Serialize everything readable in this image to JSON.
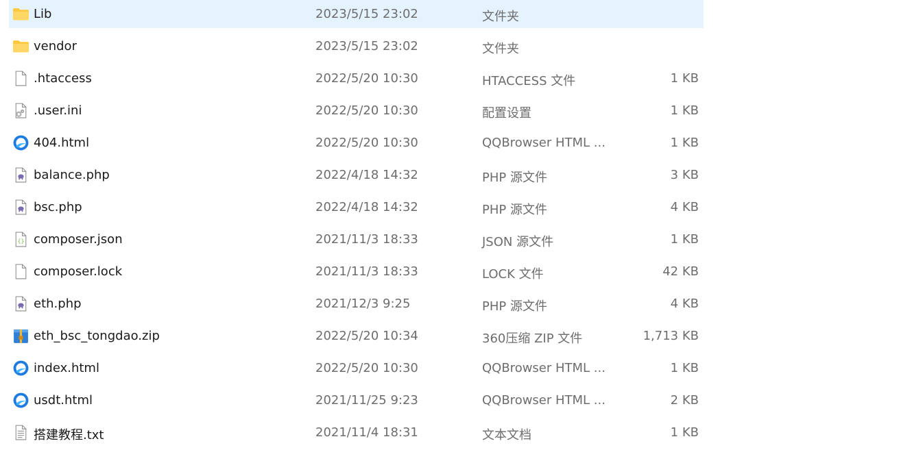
{
  "files": [
    {
      "name": "Lib",
      "date": "2023/5/15 23:02",
      "type": "文件夹",
      "size": "",
      "icon": "folder-icon",
      "selected": true
    },
    {
      "name": "vendor",
      "date": "2023/5/15 23:02",
      "type": "文件夹",
      "size": "",
      "icon": "folder-icon"
    },
    {
      "name": ".htaccess",
      "date": "2022/5/20 10:30",
      "type": "HTACCESS 文件",
      "size": "1 KB",
      "icon": "blank-file-icon"
    },
    {
      "name": ".user.ini",
      "date": "2022/5/20 10:30",
      "type": "配置设置",
      "size": "1 KB",
      "icon": "config-file-icon"
    },
    {
      "name": "404.html",
      "date": "2022/5/20 10:30",
      "type": "QQBrowser HTML ...",
      "size": "1 KB",
      "icon": "qqbrowser-icon"
    },
    {
      "name": "balance.php",
      "date": "2022/4/18 14:32",
      "type": "PHP 源文件",
      "size": "3 KB",
      "icon": "php-file-icon"
    },
    {
      "name": "bsc.php",
      "date": "2022/4/18 14:32",
      "type": "PHP 源文件",
      "size": "4 KB",
      "icon": "php-file-icon"
    },
    {
      "name": "composer.json",
      "date": "2021/11/3 18:33",
      "type": "JSON 源文件",
      "size": "1 KB",
      "icon": "json-file-icon"
    },
    {
      "name": "composer.lock",
      "date": "2021/11/3 18:33",
      "type": "LOCK 文件",
      "size": "42 KB",
      "icon": "blank-file-icon"
    },
    {
      "name": "eth.php",
      "date": "2021/12/3 9:25",
      "type": "PHP 源文件",
      "size": "4 KB",
      "icon": "php-file-icon"
    },
    {
      "name": "eth_bsc_tongdao.zip",
      "date": "2022/5/20 10:34",
      "type": "360压缩 ZIP 文件",
      "size": "1,713 KB",
      "icon": "zip-archive-icon"
    },
    {
      "name": "index.html",
      "date": "2022/5/20 10:30",
      "type": "QQBrowser HTML ...",
      "size": "1 KB",
      "icon": "qqbrowser-icon"
    },
    {
      "name": "usdt.html",
      "date": "2021/11/25 9:23",
      "type": "QQBrowser HTML ...",
      "size": "2 KB",
      "icon": "qqbrowser-icon"
    },
    {
      "name": "搭建教程.txt",
      "date": "2021/11/4 18:31",
      "type": "文本文档",
      "size": "1 KB",
      "icon": "text-file-icon"
    }
  ],
  "colors": {
    "selection": "#e5f3ff",
    "folder": "#ffc83d",
    "qqbrowser": "#1e7be0",
    "php": "#7a6bb0"
  }
}
